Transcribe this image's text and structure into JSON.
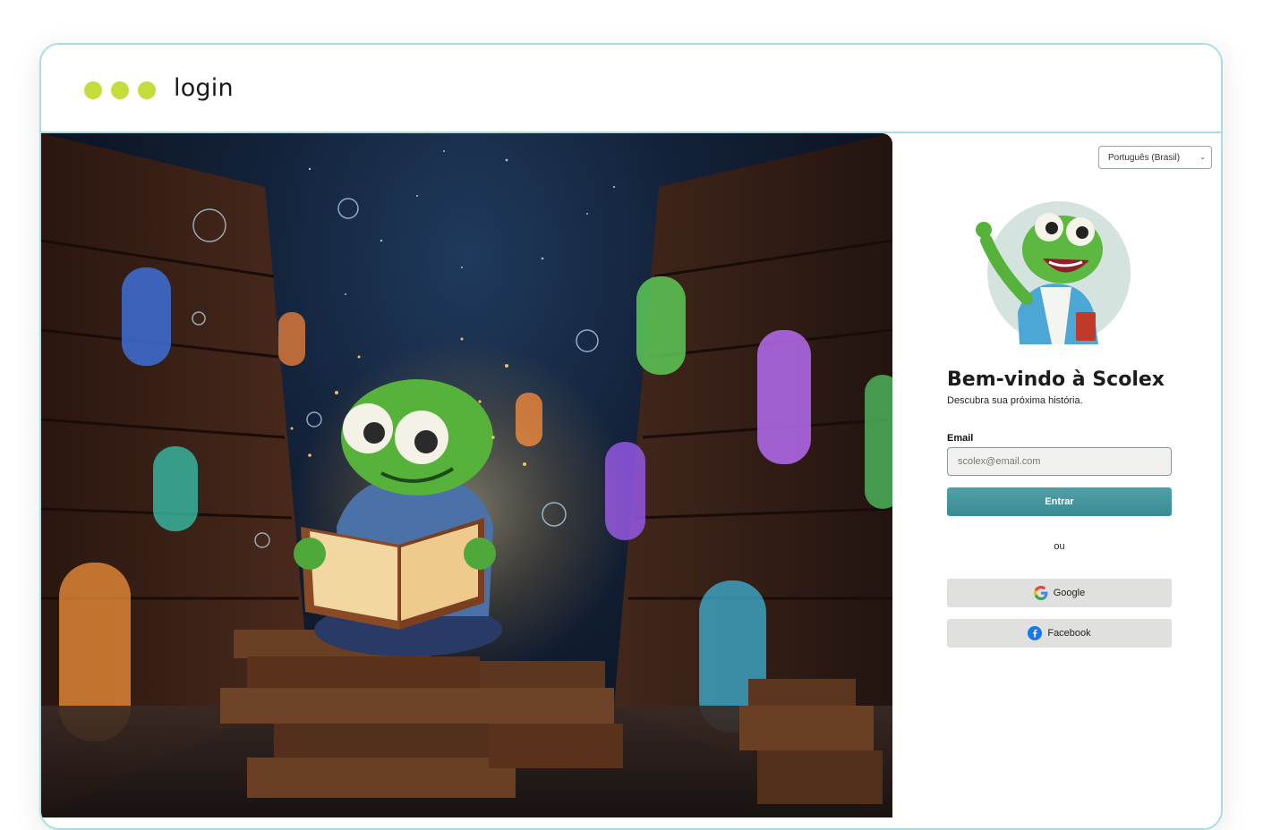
{
  "window": {
    "title": "login",
    "dots": [
      "#c6dc3c",
      "#c6dc3c",
      "#c6dc3c"
    ]
  },
  "hero": {
    "image": "chameleon-reading-library-illustration"
  },
  "panel": {
    "language": "Português (Brasil)",
    "avatar": "chameleon-mascot-waving",
    "title": "Bem-vindo à Scolex",
    "subtitle": "Descubra sua próxima história.",
    "email_label": "Email",
    "email_placeholder": "scolex@email.com",
    "email_value": "",
    "submit_label": "Entrar",
    "or_label": "ou",
    "google_label": "Google",
    "facebook_label": "Facebook"
  },
  "colors": {
    "accent": "#3f8f97",
    "frame_border": "#a9dde3",
    "social_bg": "#e0e0de"
  }
}
